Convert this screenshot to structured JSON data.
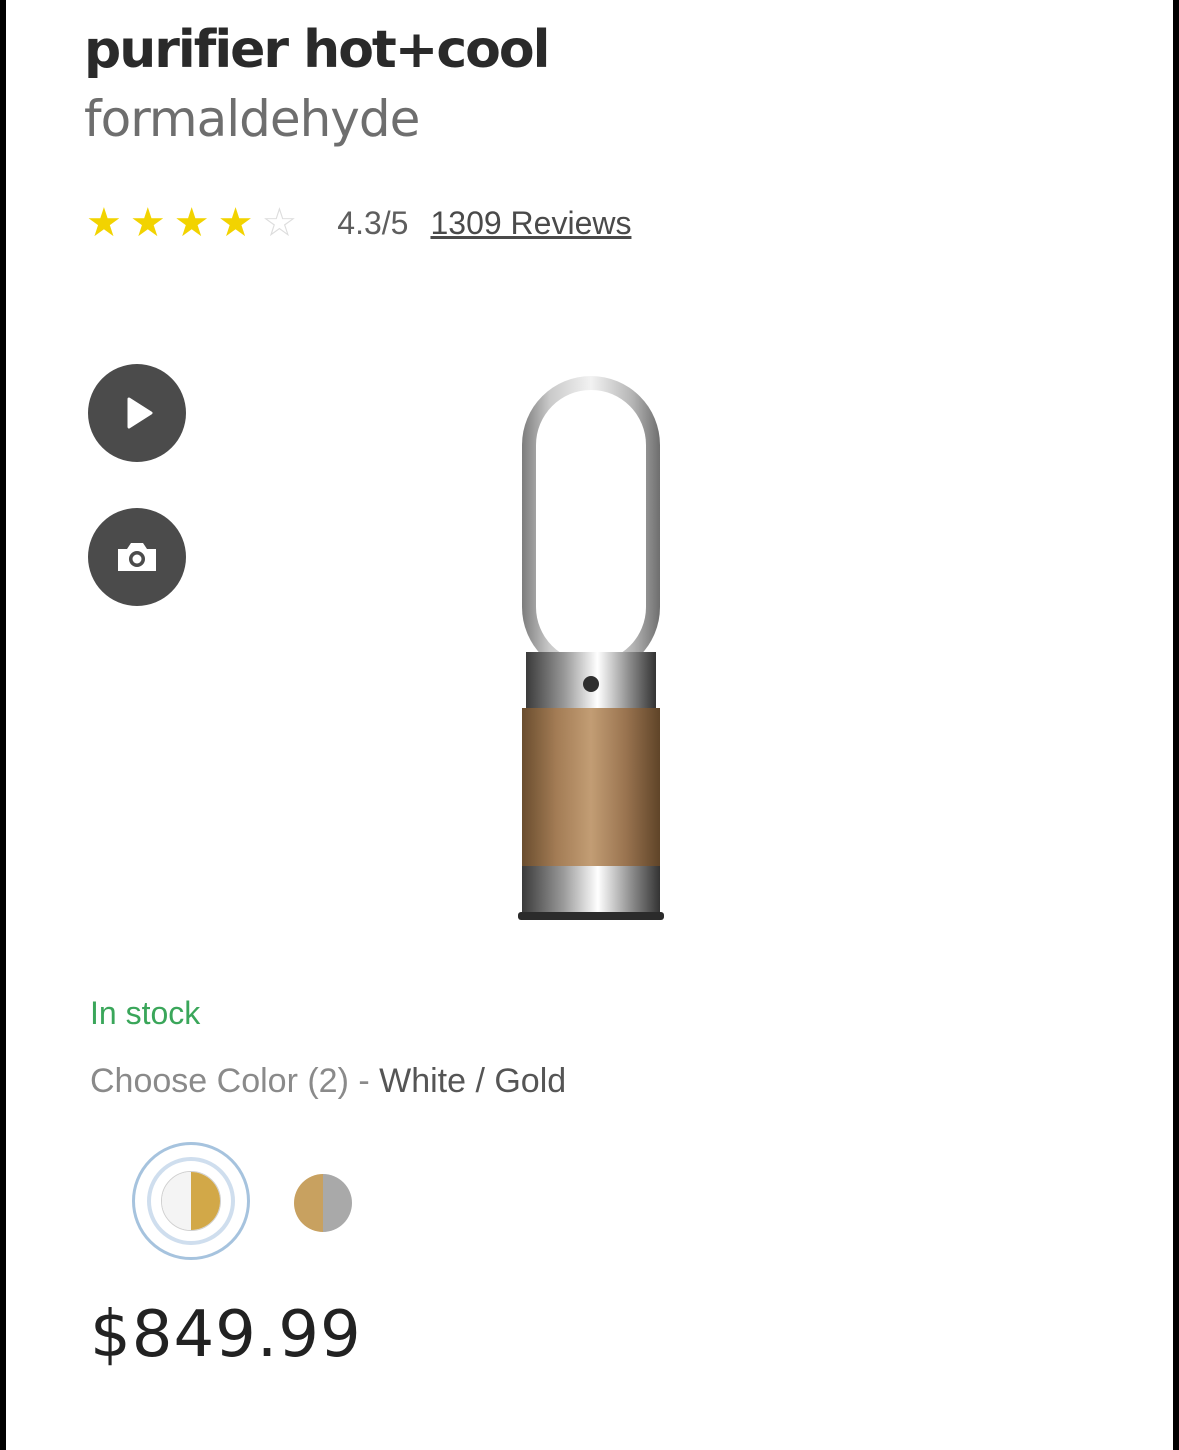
{
  "product": {
    "title": "purifier hot+cool",
    "subtitle": "formaldehyde"
  },
  "rating": {
    "score_text": "4.3/5",
    "reviews_text": "1309 Reviews",
    "stars_filled": 4,
    "stars_total": 5,
    "star_color": "#f2d300"
  },
  "media_buttons": [
    {
      "icon": "play-icon"
    },
    {
      "icon": "camera-icon"
    }
  ],
  "availability": {
    "status_text": "In stock",
    "status_color": "#3aa65a"
  },
  "color_selector": {
    "label": "Choose Color (2) - ",
    "selected_name": "White / Gold",
    "options": [
      {
        "name": "White / Gold",
        "colors": [
          "#f4f4f4",
          "#d2a848"
        ],
        "selected": true
      },
      {
        "name": "Gold / Nickel",
        "colors": [
          "#c8a160",
          "#a9a9a9"
        ],
        "selected": false
      }
    ]
  },
  "price": {
    "text": "$849.99"
  }
}
